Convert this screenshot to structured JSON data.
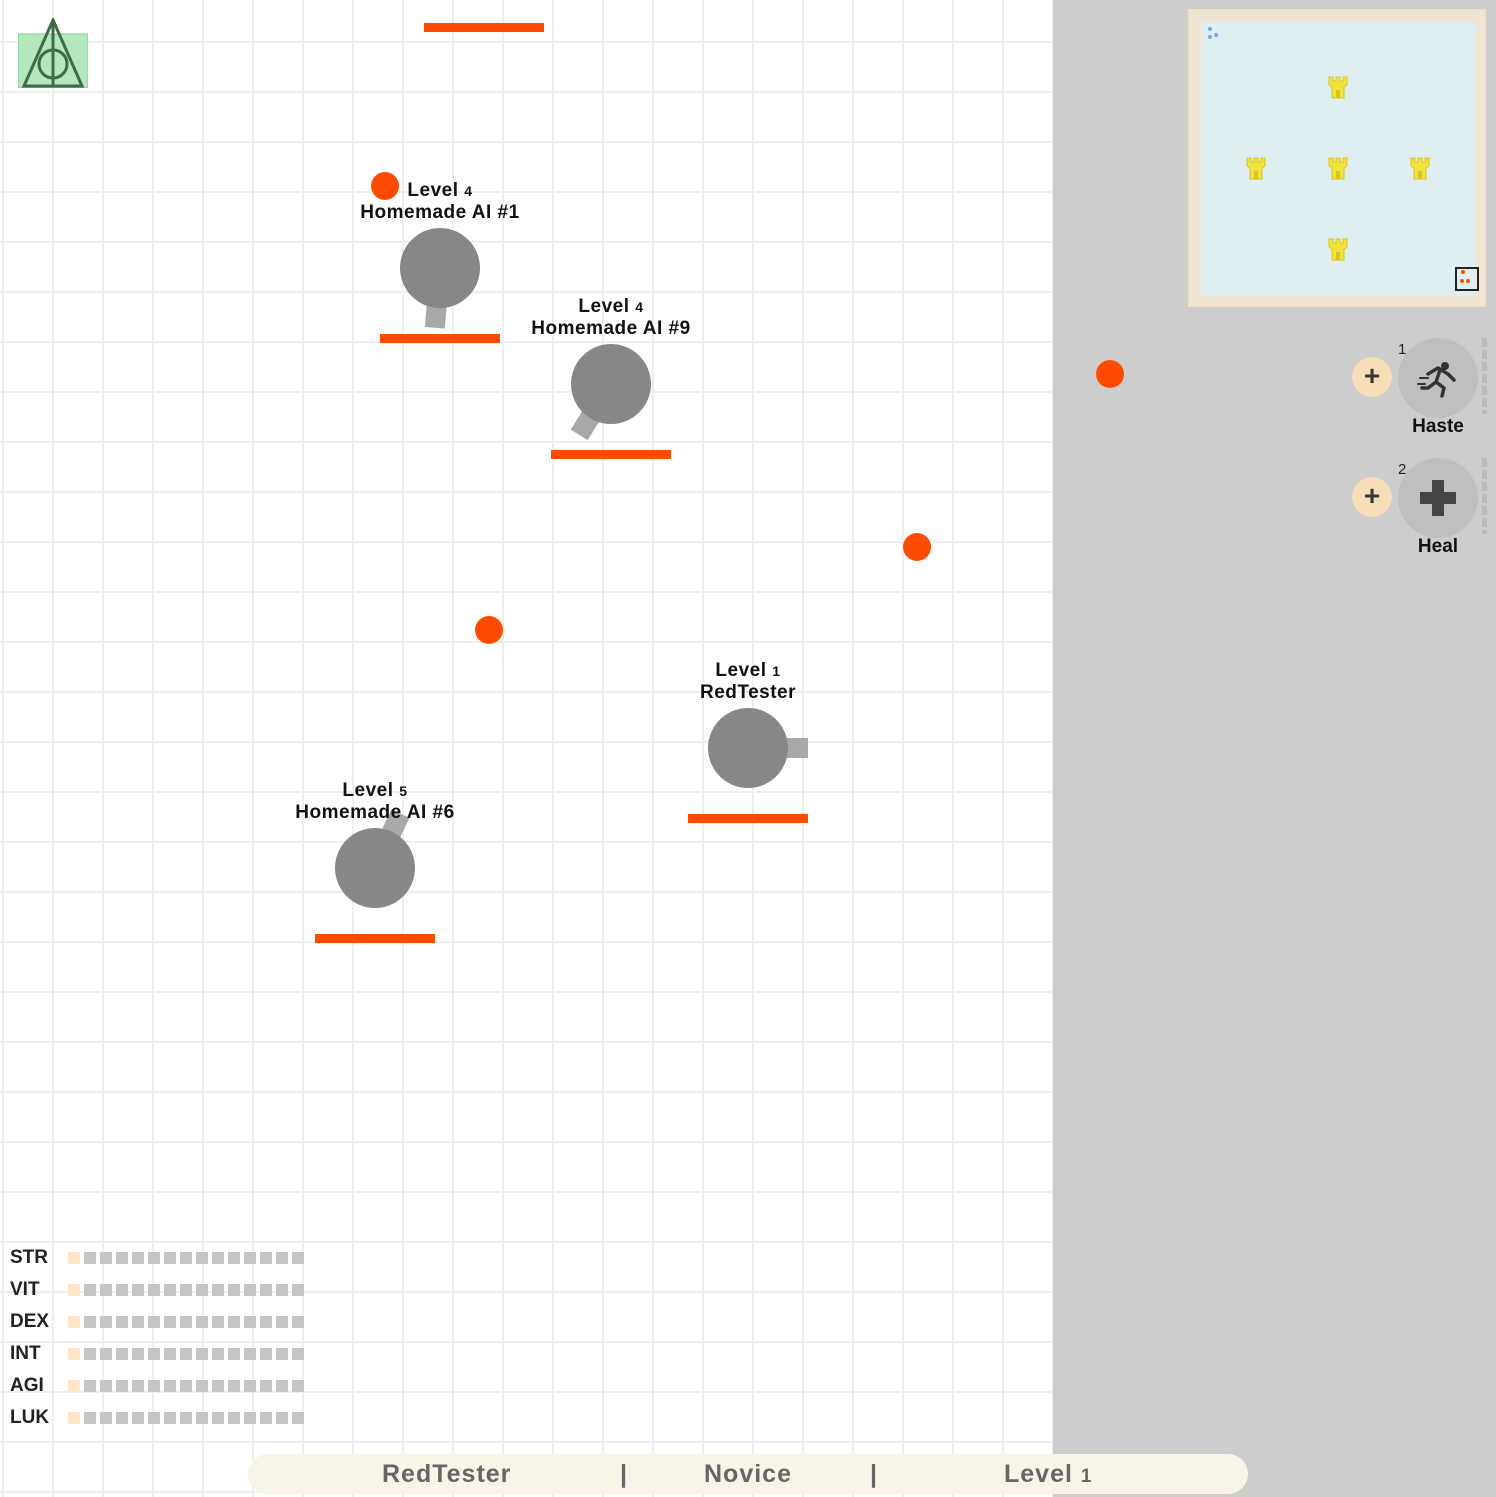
{
  "logo": {
    "icon": "deathly-hallows-icon",
    "bg_color": "#b3e8bd"
  },
  "colors": {
    "accent": "#ff4a00",
    "tank_body": "#878787",
    "barrel": "#a8a8a8",
    "sidebar_bg": "#cdcdcd",
    "minimap_bg": "#dfeef0",
    "tower": "#f4e23c"
  },
  "players": [
    {
      "level_word": "Level",
      "level_num": "4",
      "name": "Homemade AI #1",
      "barrel_angle_deg": 95,
      "health": 1.0
    },
    {
      "level_word": "Level",
      "level_num": "4",
      "name": "Homemade AI #9",
      "barrel_angle_deg": 122,
      "health": 1.0
    },
    {
      "level_word": "Level",
      "level_num": "1",
      "name": "RedTester",
      "barrel_angle_deg": 0,
      "health": 1.0
    },
    {
      "level_word": "Level",
      "level_num": "5",
      "name": "Homemade AI #6",
      "barrel_angle_deg": -65,
      "health": 1.0
    }
  ],
  "minimap": {
    "tower_count": 5,
    "tower_icon": "tower-icon"
  },
  "skills": [
    {
      "key": "1",
      "name": "Haste",
      "icon": "running-man-icon",
      "upgrade_icon": "plus-icon"
    },
    {
      "key": "2",
      "name": "Heal",
      "icon": "heal-cross-icon",
      "upgrade_icon": "plus-icon"
    }
  ],
  "stats": [
    {
      "label": "STR",
      "points": 1,
      "max": 15
    },
    {
      "label": "VIT",
      "points": 1,
      "max": 15
    },
    {
      "label": "DEX",
      "points": 1,
      "max": 15
    },
    {
      "label": "INT",
      "points": 1,
      "max": 15
    },
    {
      "label": "AGI",
      "points": 1,
      "max": 15
    },
    {
      "label": "LUK",
      "points": 1,
      "max": 15
    }
  ],
  "bottom_bar": {
    "player_name": "RedTester",
    "separator1": "|",
    "class_name": "Novice",
    "separator2": "|",
    "level_word": "Level",
    "level_num": "1"
  }
}
